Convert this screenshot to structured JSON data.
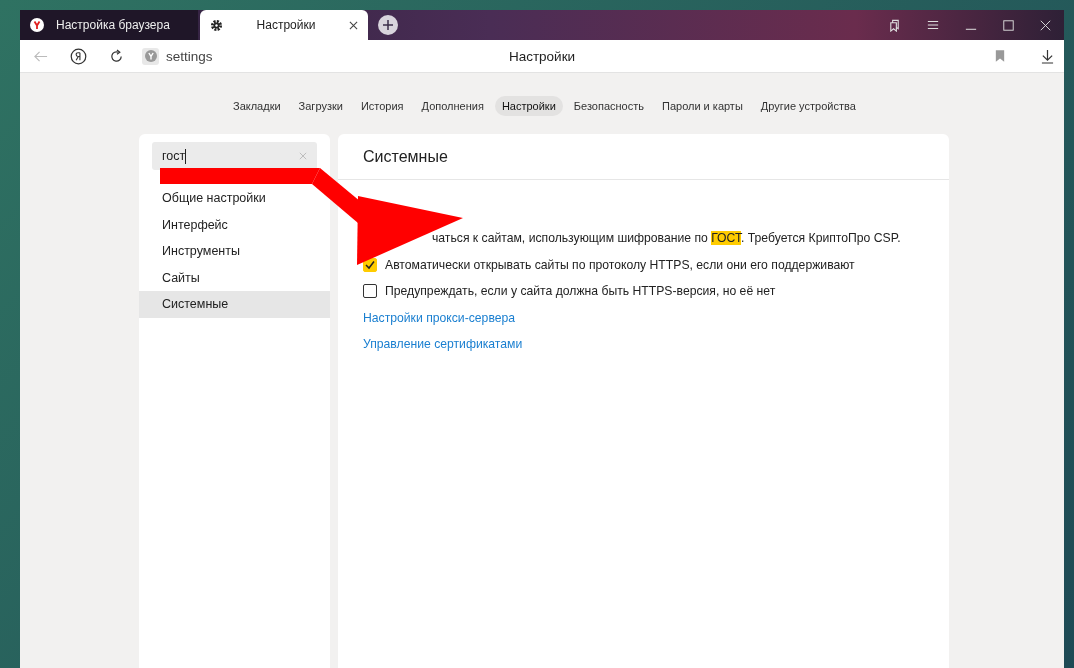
{
  "browser_tabs": [
    {
      "title": "Настройка браузера",
      "selected": false,
      "kind": "yandex"
    },
    {
      "title": "Настройки",
      "selected": true,
      "kind": "settings"
    }
  ],
  "address_bar": {
    "url": "settings",
    "page_title": "Настройки"
  },
  "nav_tabs": [
    {
      "label": "Закладки",
      "selected": false
    },
    {
      "label": "Загрузки",
      "selected": false
    },
    {
      "label": "История",
      "selected": false
    },
    {
      "label": "Дополнения",
      "selected": false
    },
    {
      "label": "Настройки",
      "selected": true
    },
    {
      "label": "Безопасность",
      "selected": false
    },
    {
      "label": "Пароли и карты",
      "selected": false
    },
    {
      "label": "Другие устройства",
      "selected": false
    }
  ],
  "search": {
    "value": "гост"
  },
  "sidebar": {
    "items": [
      {
        "label": "Общие настройки",
        "selected": false
      },
      {
        "label": "Интерфейс",
        "selected": false
      },
      {
        "label": "Инструменты",
        "selected": false
      },
      {
        "label": "Сайты",
        "selected": false
      },
      {
        "label": "Системные",
        "selected": true
      }
    ]
  },
  "section": {
    "title": "Системные",
    "options": [
      {
        "kind": "partial",
        "text": "чаться к сайтам, использующим шифрование по ",
        "highlight": "ГОСТ",
        "text_after": ". Требуется КриптоПро CSP."
      },
      {
        "kind": "checkbox",
        "label": "Автоматически открывать сайты по протоколу HTTPS, если они его поддерживают",
        "checked": true
      },
      {
        "kind": "checkbox",
        "label": "Предупреждать, если у сайта должна быть HTTPS-версия, но её нет",
        "checked": false
      }
    ],
    "links": [
      "Настройки прокси-сервера",
      "Управление сертификатами"
    ]
  }
}
